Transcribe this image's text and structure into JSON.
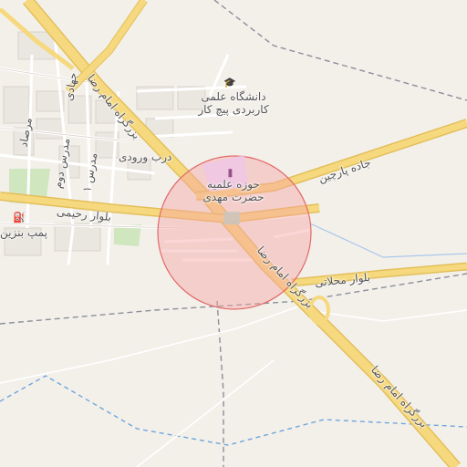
{
  "map": {
    "colors": {
      "background": "#f3f0ea",
      "highway": "#f6d97e",
      "highway_edge": "#e3bf5a",
      "street": "#ffffff",
      "street_edge": "#d8d3cb",
      "park": "#cfe6bf",
      "highlight_circle": "#f7a3a3",
      "highlight_stroke": "#e26a6a",
      "poi_area": "#efc7e6",
      "boundary": "#8a8f9a",
      "water": "#6fa6dd"
    },
    "labels": {
      "university": "دانشگاه علمی\nکاربردی پیچ کار",
      "seminary": "حوزه علمیه\nحضرت مهدی",
      "road_parchin": "جاده پارچین",
      "dorb_vorodi": "درب ورودی",
      "blvd_rahimi": "بلوار رحیمی",
      "gas_station": "پمپ بنزین",
      "blvd_mahallati": "بلوار محلاتی",
      "imam_reza_north": "بزرگراه امام رضا",
      "imam_reza_mid": "بزرگراه امام رضا",
      "imam_reza_south": "بزرگراه امام رضا",
      "morsad": "مرصاد",
      "madras_2": "مدرس دوم",
      "madras_1": "مدرس ۱",
      "jihadi": "جهادی"
    },
    "icons": {
      "university": "graduation-cap-icon",
      "seminary": "building-icon",
      "gas_station": "fuel-pump-icon"
    }
  }
}
